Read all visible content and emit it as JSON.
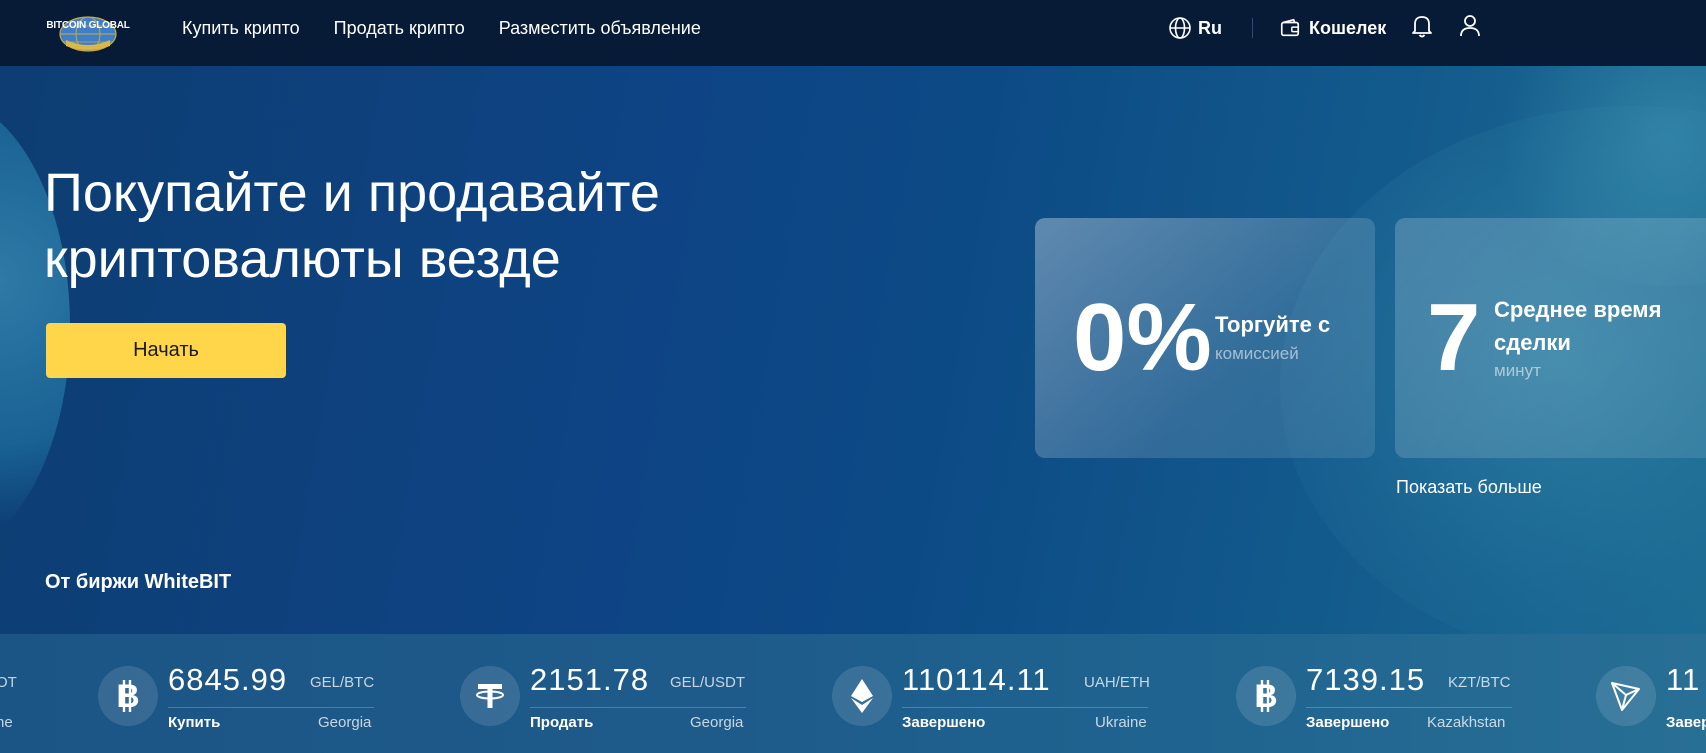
{
  "header": {
    "logo_text": "BITCOIN GLOBAL",
    "nav": [
      {
        "label": "Купить крипто"
      },
      {
        "label": "Продать крипто"
      },
      {
        "label": "Разместить объявление"
      }
    ],
    "language": "Ru",
    "wallet_label": "Кошелек"
  },
  "hero": {
    "title_line1": "Покупайте и продавайте",
    "title_line2": "криптовалюты везде",
    "start_button": "Начать",
    "from_exchange": "От биржи WhiteBIT",
    "show_more": "Показать больше",
    "cards": [
      {
        "big": "0%",
        "title": "Торгуйте с",
        "subtitle": "комиссией"
      },
      {
        "big": "7",
        "title": "Среднее время сделки",
        "subtitle": "минут"
      }
    ]
  },
  "ticker": {
    "partial_left_top": "OT",
    "partial_left_bottom": "ne",
    "items": [
      {
        "coin": "btc-icon",
        "price": "6845.99",
        "pair": "GEL/BTC",
        "status": "Купить",
        "country": "Georgia"
      },
      {
        "coin": "usdt-icon",
        "price": "2151.78",
        "pair": "GEL/USDT",
        "status": "Продать",
        "country": "Georgia"
      },
      {
        "coin": "eth-icon",
        "price": "110114.11",
        "pair": "UAH/ETH",
        "status": "Завершено",
        "country": "Ukraine"
      },
      {
        "coin": "btc-icon",
        "price": "7139.15",
        "pair": "KZT/BTC",
        "status": "Завершено",
        "country": "Kazakhstan"
      },
      {
        "coin": "trx-icon",
        "price": "11",
        "pair": "",
        "status": "Завер",
        "country": ""
      }
    ]
  },
  "colors": {
    "header_bg": "#071a36",
    "accent_yellow": "#ffd64a",
    "hero_blue": "#0e4485"
  }
}
